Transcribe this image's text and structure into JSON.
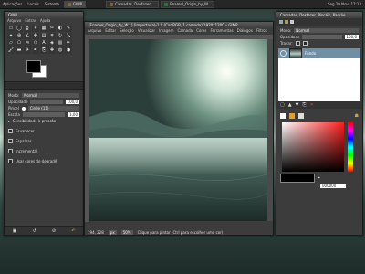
{
  "panel": {
    "menus": [
      "Aplicações",
      "Locais",
      "Sistema"
    ],
    "tasks": [
      {
        "label": "GIMP",
        "color": "#7a6240"
      },
      {
        "label": "Camadas, Desfazer ...",
        "color": "#7a6240"
      },
      {
        "label": "Enamel_Origin_by_W...",
        "color": "#2f6f42"
      }
    ],
    "clock": "Seg 29 Nov, 17:13"
  },
  "toolbox": {
    "title": "GIMP",
    "menu": [
      "Arquivo",
      "Extras",
      "Ajuda"
    ],
    "tools": [
      {
        "icon": "rect-select-icon",
        "glyph": "▭"
      },
      {
        "icon": "ellipse-select-icon",
        "glyph": "◯"
      },
      {
        "icon": "lasso-icon",
        "glyph": "ϱ"
      },
      {
        "icon": "fuzzy-select-icon",
        "glyph": "✶"
      },
      {
        "icon": "color-select-icon",
        "glyph": "▦"
      },
      {
        "icon": "scissors-icon",
        "glyph": "✂"
      },
      {
        "icon": "foreground-select-icon",
        "glyph": "◐"
      },
      {
        "icon": "paths-icon",
        "glyph": "✎"
      },
      {
        "icon": "color-picker-icon",
        "glyph": "⌖"
      },
      {
        "icon": "zoom-icon",
        "glyph": "⊕"
      },
      {
        "icon": "measure-icon",
        "glyph": "∠"
      },
      {
        "icon": "move-icon",
        "glyph": "✥"
      },
      {
        "icon": "align-icon",
        "glyph": "▤"
      },
      {
        "icon": "crop-icon",
        "glyph": "⌗"
      },
      {
        "icon": "rotate-icon",
        "glyph": "↻"
      },
      {
        "icon": "scale-icon",
        "glyph": "⤡"
      },
      {
        "icon": "shear-icon",
        "glyph": "▱"
      },
      {
        "icon": "perspective-icon",
        "glyph": "⬠"
      },
      {
        "icon": "flip-icon",
        "glyph": "⇋"
      },
      {
        "icon": "cage-icon",
        "glyph": "⬡"
      },
      {
        "icon": "text-icon",
        "glyph": "A"
      },
      {
        "icon": "bucket-fill-icon",
        "glyph": "◈"
      },
      {
        "icon": "blend-icon",
        "glyph": "▥"
      },
      {
        "icon": "pencil-icon",
        "glyph": "✏"
      },
      {
        "icon": "paintbrush-icon",
        "glyph": "🖌"
      },
      {
        "icon": "eraser-icon",
        "glyph": "▬"
      },
      {
        "icon": "airbrush-icon",
        "glyph": "✈"
      },
      {
        "icon": "ink-icon",
        "glyph": "✒"
      },
      {
        "icon": "clone-icon",
        "glyph": "⎘"
      },
      {
        "icon": "heal-icon",
        "glyph": "✚"
      },
      {
        "icon": "blur-icon",
        "glyph": "◍"
      },
      {
        "icon": "dodge-icon",
        "glyph": "◑"
      }
    ],
    "options": {
      "mode_label": "Modo:",
      "mode_value": "Normal",
      "opacity_label": "Opacidade",
      "opacity_value": "100,0",
      "brush_label": "Pincel",
      "brush_value": "Circle (11)",
      "scale_label": "Escala",
      "scale_value": "1,00",
      "dynamics_label": "Sensibilidade à pressão",
      "checks": [
        "Esvanecer",
        "Espalhar",
        "Incremental",
        "Usar cores do degradê"
      ]
    }
  },
  "image_window": {
    "title": "[Enamel_Origin_by_W...] (importada)-1.0 (Cor RGB, 1 camada) 1920x1200 – GIMP",
    "menu": [
      "Arquivo",
      "Editar",
      "Seleção",
      "Visualizar",
      "Imagem",
      "Camada",
      "Cores",
      "Ferramentas",
      "Diálogos",
      "Filtros"
    ],
    "status": {
      "coords": "194, 228",
      "unit": "px",
      "zoom": "50%",
      "message": "Clique para pintar (Ctrl para escolher uma cor)"
    }
  },
  "layers_dock": {
    "title": "Camadas, Desfazer, Pincéis, Padrõe...",
    "mode_label": "Modo:",
    "mode_value": "Normal",
    "opacity_label": "Opacidade",
    "opacity_value": "100,0",
    "lock_label": "Travar:",
    "layer_name": "Fundo",
    "hex_value": "000000",
    "accent": "#6f8fa6"
  }
}
